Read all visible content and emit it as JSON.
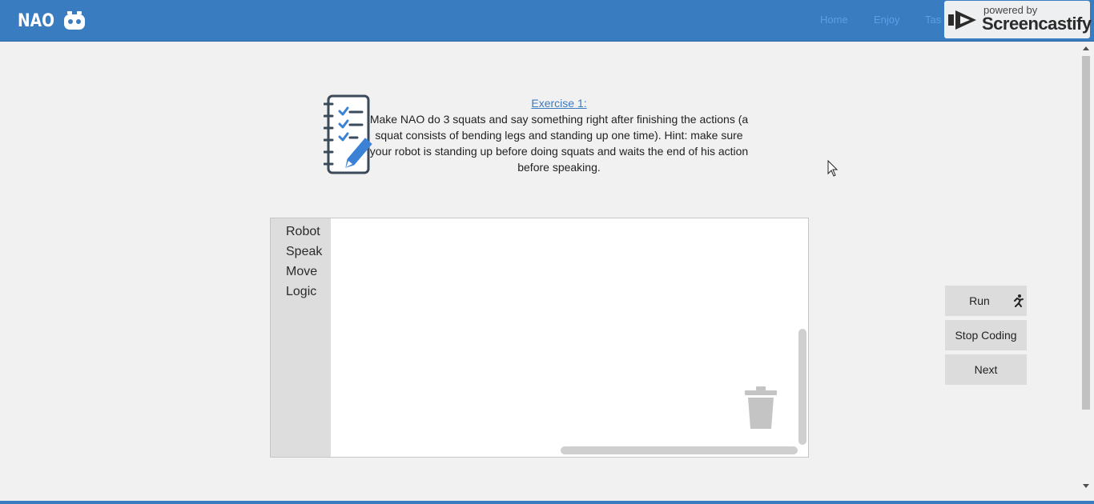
{
  "nav": {
    "brand": "NAO",
    "links": [
      "Home",
      "Enjoy",
      "Tas"
    ]
  },
  "watermark": {
    "small": "powered by",
    "big": "Screencastify"
  },
  "exercise": {
    "title": "Exercise 1:",
    "body": "Make NAO do 3 squats and say something right after finishing the actions (a squat consists of bending legs and standing up one time). Hint: make sure your robot is standing up before doing squats and waits the end of his action before speaking."
  },
  "toolbox": {
    "categories": [
      "Robot",
      "Speak",
      "Move",
      "Logic"
    ]
  },
  "controls": {
    "run": "Run",
    "stop": "Stop Coding",
    "next": "Next"
  },
  "icons": {
    "exercise": "checklist-pencil-icon",
    "run": "running-person-icon",
    "trash": "trash-can-icon",
    "watermark": "screencastify-logo-icon"
  },
  "colors": {
    "header": "#3a7cc0",
    "link": "#3a7cc0",
    "button": "#dcdcdc"
  }
}
